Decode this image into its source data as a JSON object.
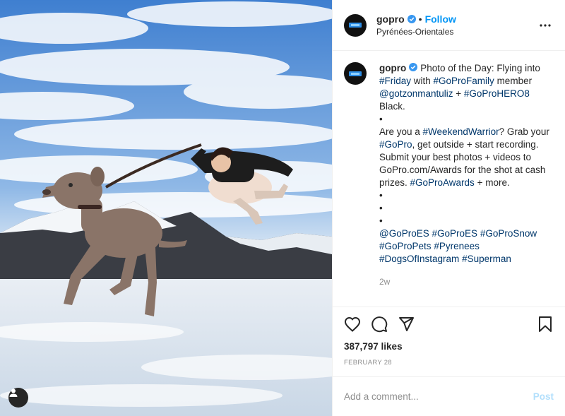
{
  "header": {
    "username": "gopro",
    "dot": "•",
    "follow_label": "Follow",
    "location": "Pyrénées-Orientales"
  },
  "caption": {
    "username": "gopro",
    "lines": [
      [
        {
          "t": "Photo of the Day: Flying into "
        },
        {
          "t": "#Friday",
          "link": true
        },
        {
          "t": " with "
        },
        {
          "t": "#GoProFamily",
          "link": true
        },
        {
          "t": " member "
        },
        {
          "t": "@gotzonmantuliz",
          "link": true
        },
        {
          "t": " + "
        },
        {
          "t": "#GoProHERO8",
          "link": true
        },
        {
          "t": " Black."
        }
      ],
      [
        {
          "t": "•"
        }
      ],
      [
        {
          "t": "Are you a "
        },
        {
          "t": "#WeekendWarrior",
          "link": true
        },
        {
          "t": "? Grab your "
        },
        {
          "t": "#GoPro",
          "link": true
        },
        {
          "t": ", get outside + start recording. Submit your best photos + videos to GoPro.com/Awards for the shot at cash prizes. "
        },
        {
          "t": "#GoProAwards",
          "link": true
        },
        {
          "t": " + more."
        }
      ],
      [
        {
          "t": "•"
        }
      ],
      [
        {
          "t": "•"
        }
      ],
      [
        {
          "t": "•"
        }
      ],
      [
        {
          "t": "@GoProES",
          "link": true
        },
        {
          "t": " "
        },
        {
          "t": "#GoProES",
          "link": true
        },
        {
          "t": " "
        },
        {
          "t": "#GoProSnow",
          "link": true
        },
        {
          "t": " "
        },
        {
          "t": "#GoProPets",
          "link": true
        },
        {
          "t": " "
        },
        {
          "t": "#Pyrenees",
          "link": true
        },
        {
          "t": " "
        },
        {
          "t": "#DogsOfInstagram",
          "link": true
        },
        {
          "t": " "
        },
        {
          "t": "#Superman",
          "link": true
        }
      ]
    ],
    "time_ago": "2w"
  },
  "stats": {
    "likes": "387,797 likes",
    "date": "FEBRUARY 28"
  },
  "comment": {
    "placeholder": "Add a comment...",
    "post_label": "Post"
  },
  "colors": {
    "link": "#00376b",
    "follow": "#0095f6",
    "verified": "#3897f0",
    "muted": "#8e8e8e",
    "post_disabled": "#b2dffc"
  },
  "icons": {
    "like": "heart-icon",
    "comment": "comment-bubble-icon",
    "share": "paper-plane-icon",
    "save": "bookmark-icon",
    "more": "more-options-icon",
    "verified": "verified-badge-icon",
    "user_tags": "user-icon"
  }
}
